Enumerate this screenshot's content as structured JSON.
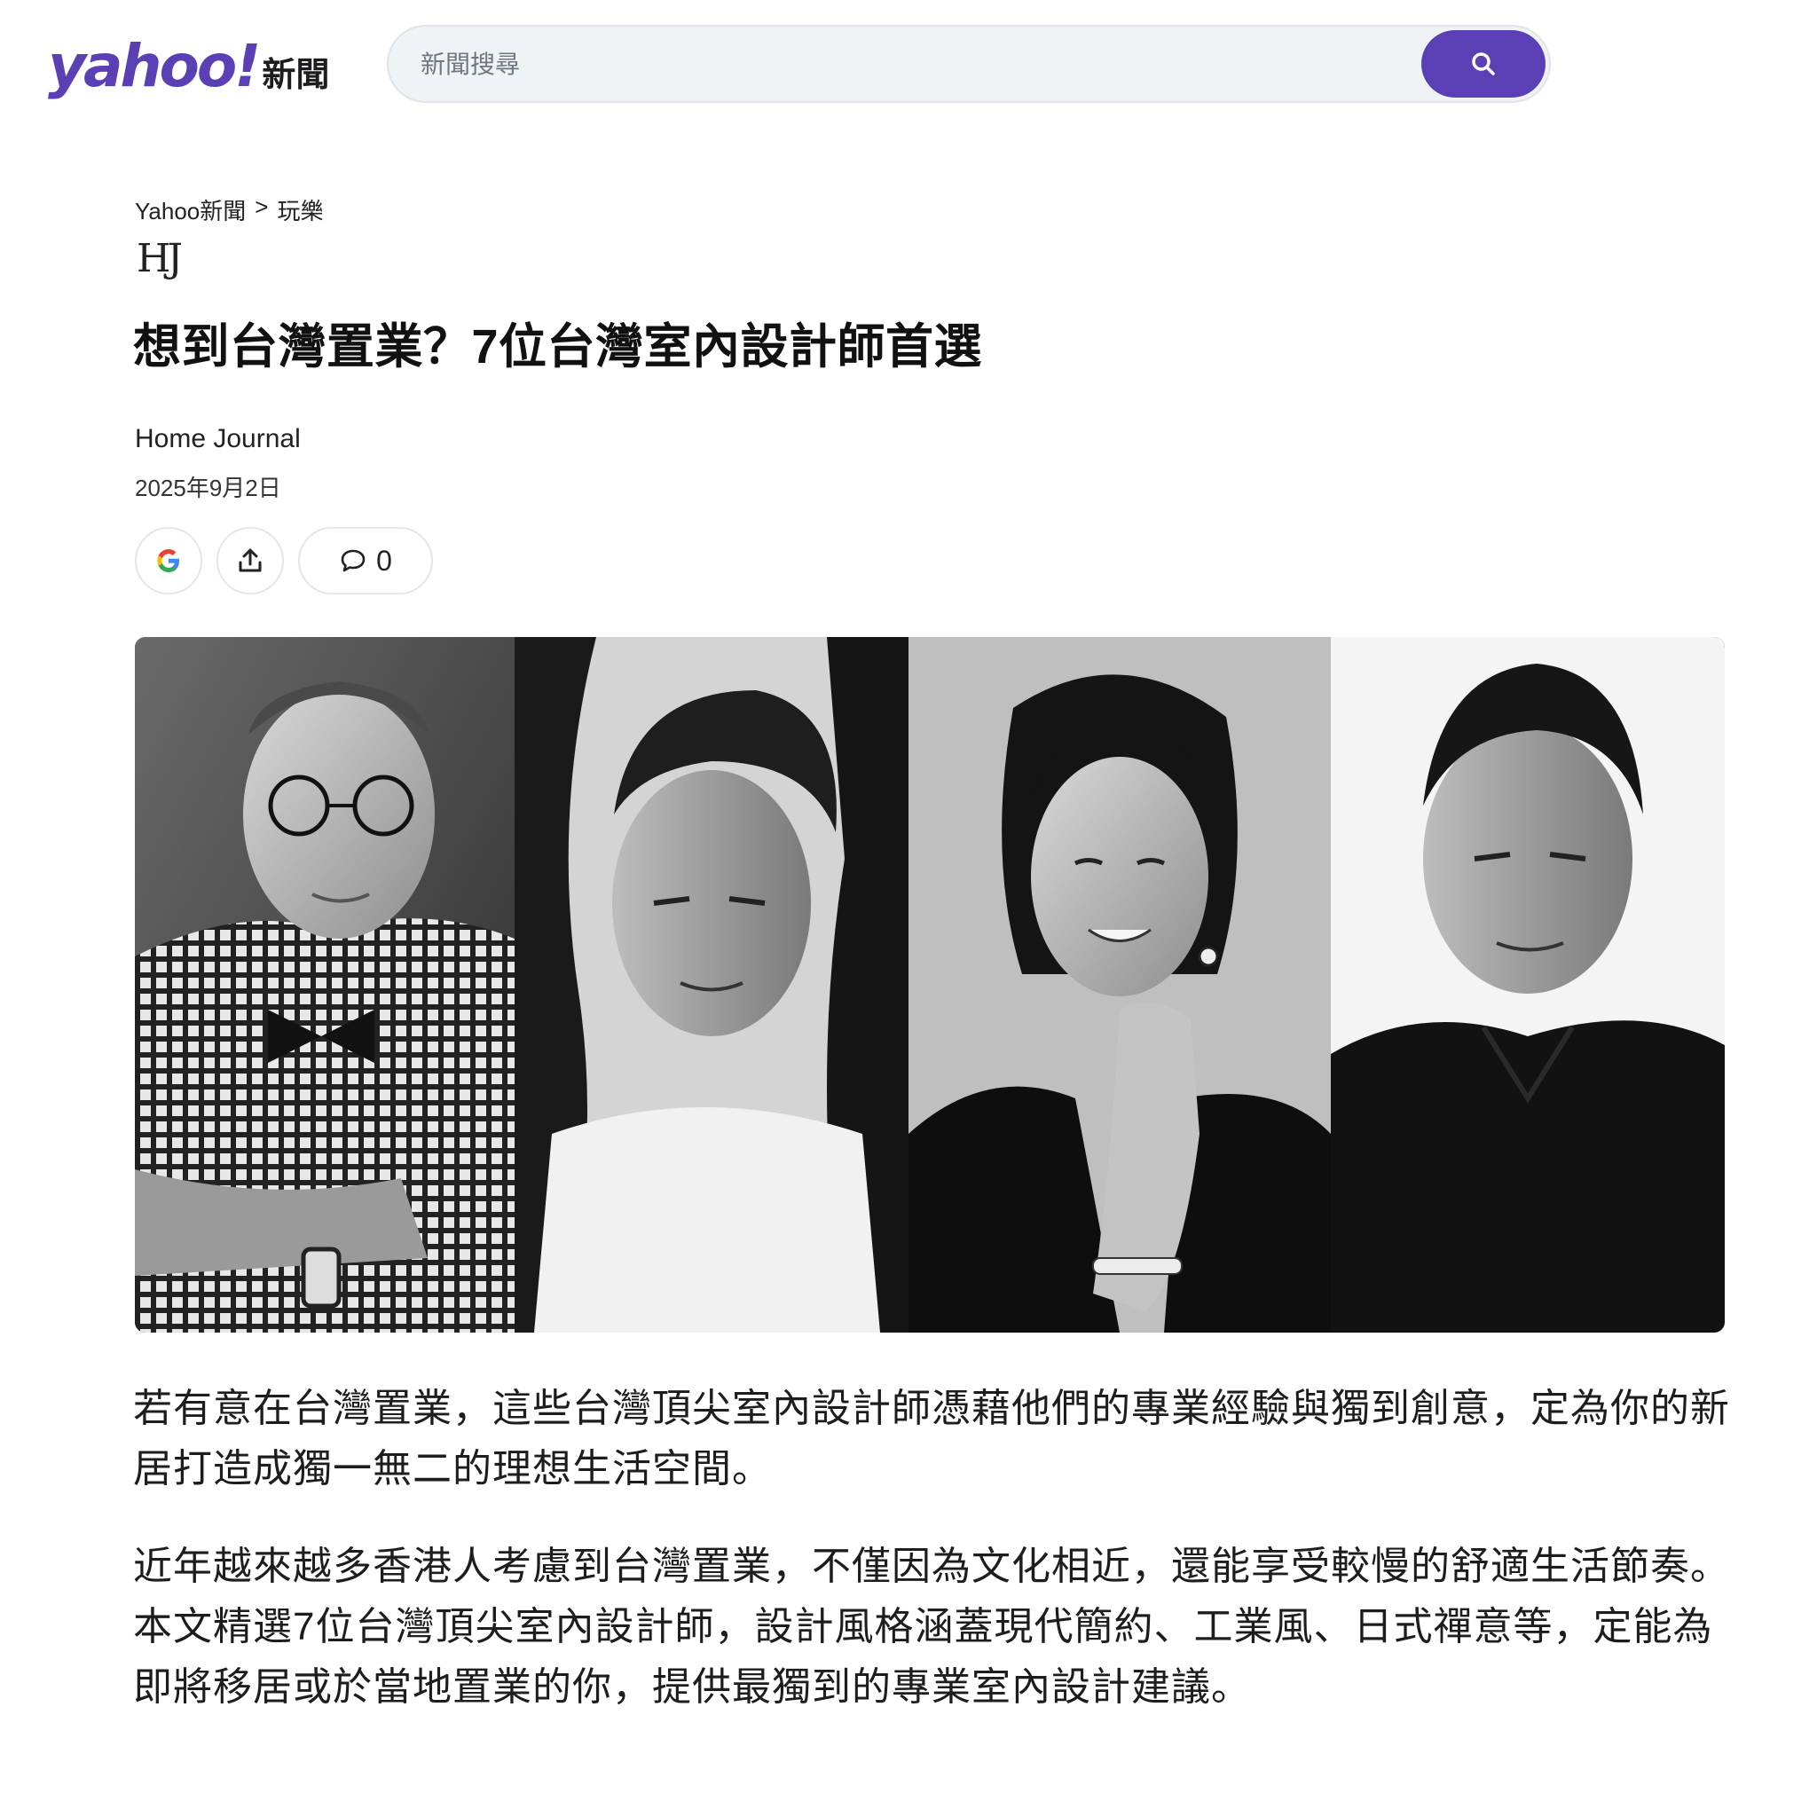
{
  "header": {
    "logo_main": "yahoo!",
    "logo_sub": "新聞",
    "search_placeholder": "新聞搜尋",
    "search_icon": "search-icon"
  },
  "breadcrumb": {
    "home": "Yahoo新聞",
    "separator": ">",
    "section": "玩樂"
  },
  "publisher_logo": "HJ",
  "article": {
    "title": "想到台灣置業？7位台灣室內設計師首選",
    "author": "Home Journal",
    "date": "2025年9月2日",
    "comment_count": "0",
    "paragraphs": [
      "若有意在台灣置業，這些台灣頂尖室內設計師憑藉他們的專業經驗與獨到創意，定為你的新居打造成獨一無二的理想生活空間。",
      "近年越來越多香港人考慮到台灣置業，不僅因為文化相近，還能享受較慢的舒適生活節奏。本文精選7位台灣頂尖室內設計師，設計風格涵蓋現代簡約、工業風、日式禪意等，定能為即將移居或於當地置業的你，提供最獨到的專業室內設計建議。"
    ]
  },
  "actions": {
    "google_icon": "google-icon",
    "share_icon": "share-icon",
    "comment_icon": "comment-icon"
  },
  "colors": {
    "brand": "#5b3fb5",
    "text": "#1d1d1f"
  }
}
